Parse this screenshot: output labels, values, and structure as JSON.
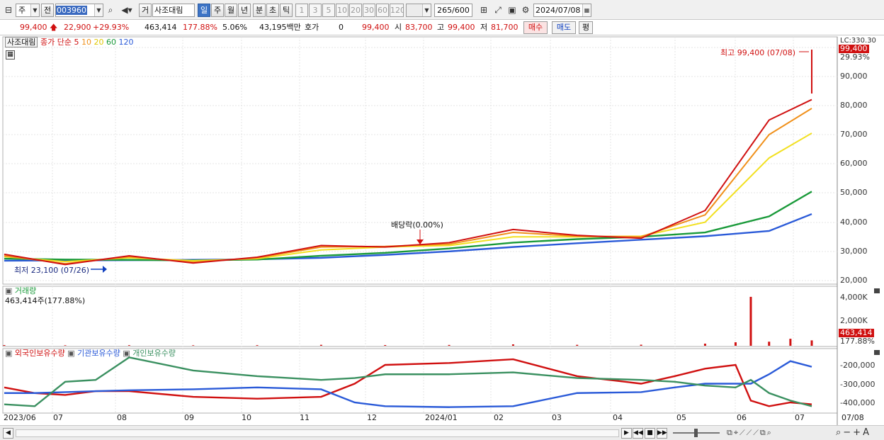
{
  "toolbar": {
    "market_code": "주",
    "prev_label": "전",
    "stock_code": "003960",
    "exchange_label": "거",
    "stock_name": "사조대림",
    "periods": [
      "일",
      "주",
      "월",
      "년",
      "분",
      "초",
      "틱"
    ],
    "selected_period": "일",
    "intervals": [
      "1",
      "3",
      "5",
      "10",
      "20",
      "30",
      "60",
      "120"
    ],
    "count": "265",
    "count_max": "/600",
    "date": "2024/07/08"
  },
  "quote": {
    "price": "99,400",
    "change": "22,900",
    "change_pct": "+29.93%",
    "volume": "463,414",
    "volume_ratio": "177.88%",
    "turnover": "5.06%",
    "amount": "43,195백만",
    "hoga_label": "호가",
    "hoga_value": "0",
    "bid_price": "99,400",
    "open_label": "시",
    "open": "83,700",
    "high_label": "고",
    "high": "99,400",
    "low_label": "저",
    "low": "81,700",
    "buy_button": "매수",
    "sell_button": "매도",
    "avg_button": "평"
  },
  "colors": {
    "candle_up": "#d01010",
    "candle_down": "#1040c0",
    "ma5": "#d01010",
    "ma10": "#f0901a",
    "ma20": "#f2e020",
    "ma60": "#1a9a3a",
    "ma120": "#2a5ad8",
    "foreign": "#d01010",
    "institution": "#2a5ad8",
    "individual": "#3a9060"
  },
  "chart_data": [
    {
      "type": "line",
      "pane": "price",
      "title": "사조대림",
      "legend": {
        "label": "종가 단순",
        "items": [
          {
            "name": "5",
            "color": "#d01010"
          },
          {
            "name": "10",
            "color": "#f0901a"
          },
          {
            "name": "20",
            "color": "#e0c800"
          },
          {
            "name": "60",
            "color": "#1a9a3a"
          },
          {
            "name": "120",
            "color": "#2a5ad8"
          }
        ]
      },
      "scale_label": "LC:330.30",
      "yticks": [
        "90,000",
        "80,000",
        "70,000",
        "60,000",
        "50,000",
        "40,000",
        "30,000",
        "20,000"
      ],
      "ylim": [
        18000,
        102000
      ],
      "x": [
        0,
        20,
        41,
        62,
        83,
        104,
        125,
        146,
        167,
        188,
        209,
        230,
        251,
        265
      ],
      "series": [
        {
          "name": "5",
          "values": [
            29000,
            25500,
            28500,
            26000,
            28000,
            32000,
            31500,
            33000,
            37500,
            35500,
            34500,
            44000,
            75000,
            82000
          ]
        },
        {
          "name": "10",
          "values": [
            28500,
            25800,
            28200,
            26300,
            27800,
            31500,
            31700,
            32500,
            36500,
            35200,
            35000,
            42500,
            70000,
            79000
          ]
        },
        {
          "name": "20",
          "values": [
            28200,
            26500,
            27800,
            26800,
            27500,
            30500,
            31500,
            32000,
            35000,
            35000,
            35200,
            40000,
            62000,
            70500
          ]
        },
        {
          "name": "60",
          "values": [
            27500,
            27200,
            27100,
            26900,
            27200,
            28500,
            29500,
            31000,
            33000,
            34200,
            35000,
            36500,
            42000,
            50500
          ]
        },
        {
          "name": "120",
          "values": [
            26800,
            26900,
            27000,
            27100,
            27300,
            27800,
            28800,
            30000,
            31500,
            32800,
            34000,
            35200,
            37000,
            42800
          ]
        }
      ],
      "annotations": {
        "high": "최고 99,400 (07/08)",
        "low": "최저 23,100 (07/26)",
        "dividend": "배당락(0.00%)"
      },
      "last_tag": "99,400",
      "last_pct": "29.93%"
    },
    {
      "type": "bar",
      "pane": "volume",
      "title": "거래량",
      "subtitle": "463,414주(177.88%)",
      "yticks": [
        "4,000K",
        "2,000K"
      ],
      "ylim": [
        0,
        4500
      ],
      "x": [
        0,
        20,
        41,
        62,
        83,
        104,
        125,
        146,
        167,
        188,
        209,
        230,
        240,
        245,
        251,
        258,
        265
      ],
      "values": [
        60,
        40,
        50,
        40,
        50,
        80,
        60,
        70,
        120,
        80,
        90,
        180,
        300,
        4200,
        350,
        600,
        463
      ],
      "last_tag": "463,414",
      "last_pct": "177.88%"
    },
    {
      "type": "line",
      "pane": "holdings",
      "legend_items": [
        "외국인보유수량",
        "기관보유수량",
        "개인보유수량"
      ],
      "yticks": [
        "-200,000",
        "-300,000",
        "-400,000"
      ],
      "ylim": [
        -440000,
        -130000
      ],
      "x": [
        0,
        10,
        20,
        30,
        41,
        62,
        83,
        104,
        115,
        125,
        146,
        167,
        188,
        209,
        220,
        230,
        240,
        245,
        251,
        258,
        265
      ],
      "series": [
        {
          "name": "외국인보유수량",
          "values": [
            -320000,
            -350000,
            -360000,
            -340000,
            -340000,
            -370000,
            -380000,
            -370000,
            -300000,
            -200000,
            -190000,
            -170000,
            -260000,
            -300000,
            -260000,
            -220000,
            -200000,
            -390000,
            -420000,
            -400000,
            -410000
          ]
        },
        {
          "name": "기관보유수량",
          "values": [
            -350000,
            -350000,
            -345000,
            -340000,
            -335000,
            -330000,
            -320000,
            -330000,
            -400000,
            -420000,
            -425000,
            -420000,
            -350000,
            -345000,
            -320000,
            -300000,
            -300000,
            -300000,
            -250000,
            -180000,
            -210000
          ]
        },
        {
          "name": "개인보유수량",
          "values": [
            -410000,
            -420000,
            -290000,
            -280000,
            -160000,
            -230000,
            -260000,
            -280000,
            -270000,
            -250000,
            -250000,
            -240000,
            -270000,
            -280000,
            -290000,
            -310000,
            -320000,
            -280000,
            -350000,
            -390000,
            -420000
          ]
        }
      ]
    }
  ],
  "x_axis": {
    "labels": [
      "2023/06",
      "07",
      "08",
      "09",
      "10",
      "11",
      "12",
      "2024/01",
      "02",
      "03",
      "04",
      "05",
      "06",
      "07"
    ],
    "end_label": "07/08"
  }
}
